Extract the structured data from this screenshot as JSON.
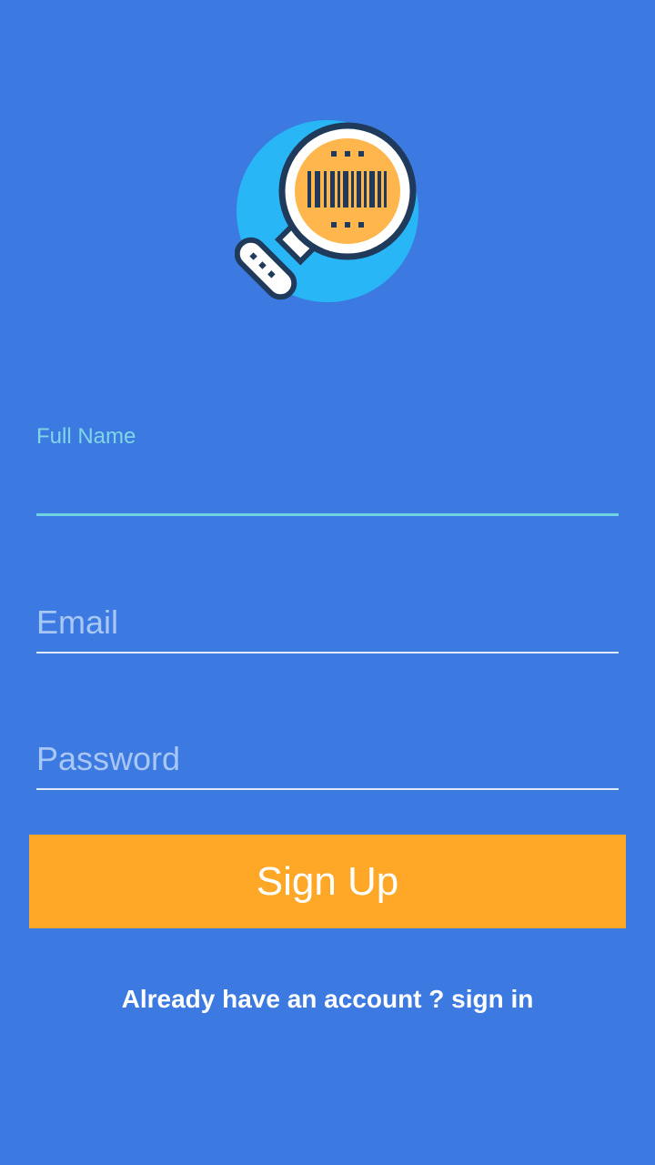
{
  "logo": {
    "icon": "barcode-magnifier-icon"
  },
  "form": {
    "full_name": {
      "label": "Full Name",
      "value": ""
    },
    "email": {
      "placeholder": "Email",
      "value": ""
    },
    "password": {
      "placeholder": "Password",
      "value": ""
    }
  },
  "actions": {
    "signup_label": "Sign Up",
    "signin_link": "Already have an account ? sign in"
  },
  "colors": {
    "background": "#3c7ae2",
    "button": "#ffa726",
    "accent": "#6fd2e0"
  }
}
